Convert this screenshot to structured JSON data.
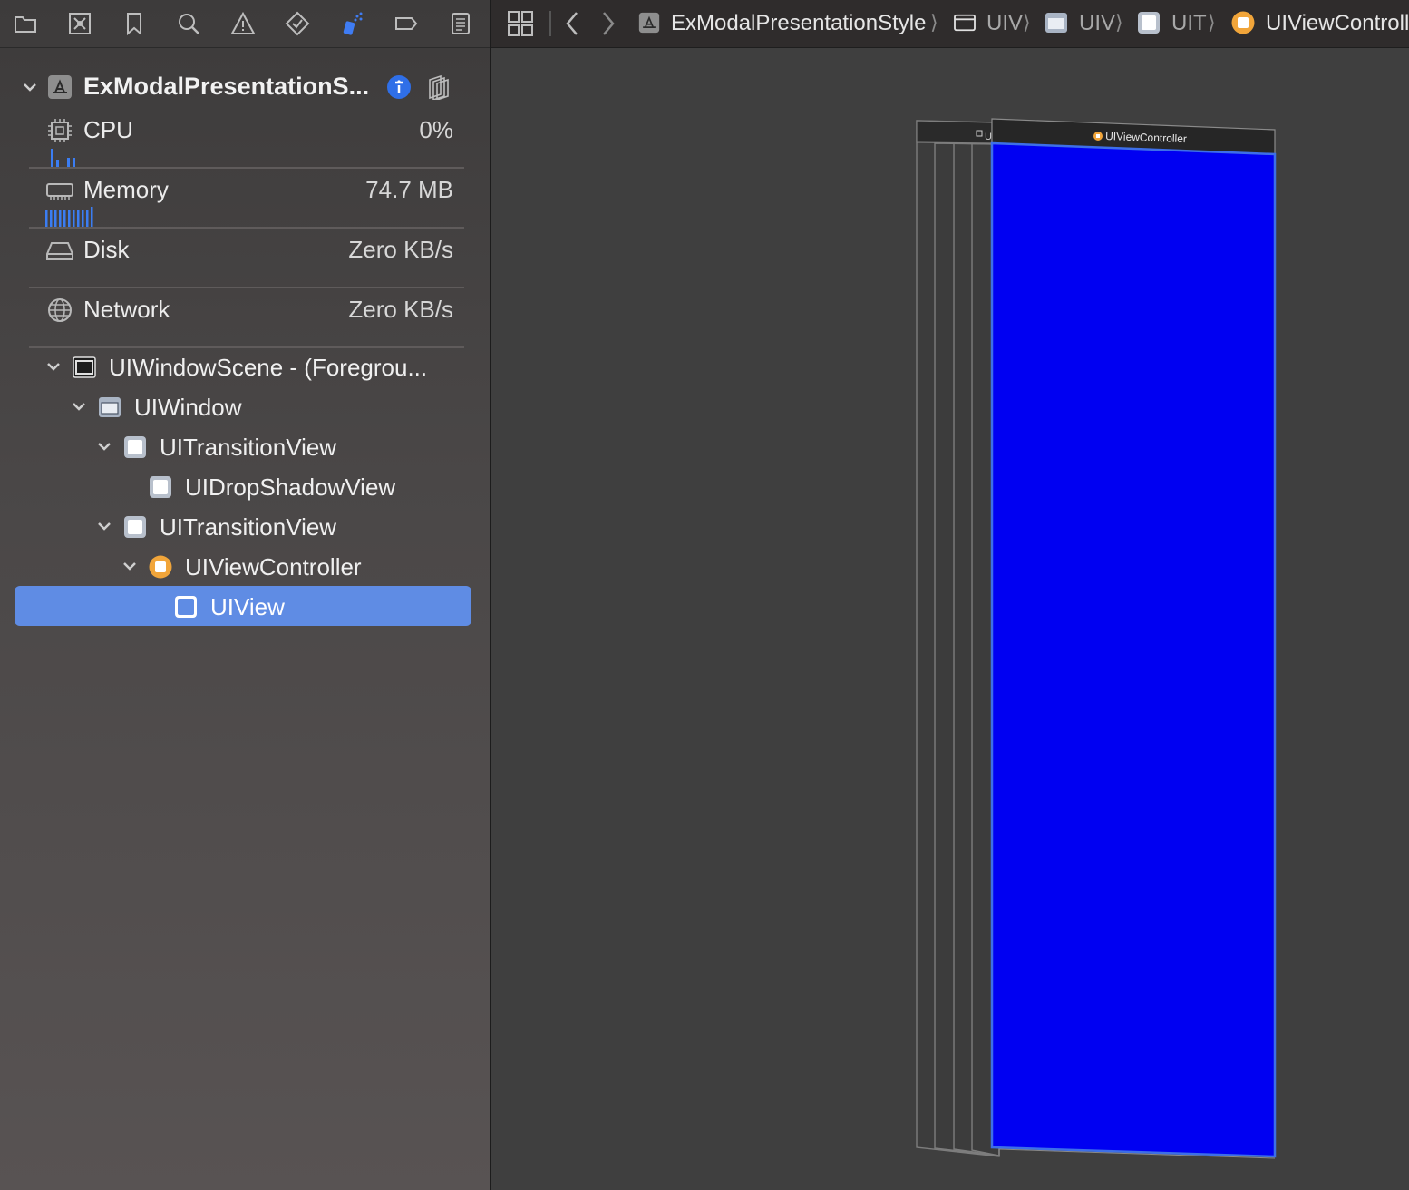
{
  "navigator": {
    "toolbar": [
      {
        "name": "project-navigator-icon"
      },
      {
        "name": "source-control-navigator-icon"
      },
      {
        "name": "bookmark-navigator-icon"
      },
      {
        "name": "find-navigator-icon"
      },
      {
        "name": "issue-navigator-icon"
      },
      {
        "name": "test-navigator-icon"
      },
      {
        "name": "debug-navigator-icon"
      },
      {
        "name": "breakpoint-navigator-icon"
      },
      {
        "name": "report-navigator-icon"
      }
    ],
    "process": {
      "title": "ExModalPresentationS...",
      "info_icon": "info-icon",
      "view_hierarchy_icon": "view-hierarchy-icon"
    },
    "gauges": [
      {
        "key": "cpu",
        "label": "CPU",
        "value": "0%",
        "icon": "cpu-icon"
      },
      {
        "key": "memory",
        "label": "Memory",
        "value": "74.7 MB",
        "icon": "memory-icon"
      },
      {
        "key": "disk",
        "label": "Disk",
        "value": "Zero KB/s",
        "icon": "disk-icon"
      },
      {
        "key": "network",
        "label": "Network",
        "value": "Zero KB/s",
        "icon": "network-icon"
      }
    ],
    "tree": [
      {
        "label": "UIWindowScene - (Foregrou...",
        "expanded": true
      },
      {
        "label": "UIWindow",
        "expanded": true
      },
      {
        "label": "UITransitionView",
        "expanded": true
      },
      {
        "label": "UIDropShadowView",
        "expanded": false
      },
      {
        "label": "UITransitionView",
        "expanded": true
      },
      {
        "label": "UIViewController",
        "expanded": true
      },
      {
        "label": "UIView",
        "selected": true
      }
    ]
  },
  "jumpbar": {
    "project": "ExModalPresentationStyle",
    "crumbs": [
      "UIV",
      "UIV",
      "UIT"
    ],
    "last": "UIViewControll"
  },
  "canvas": {
    "view_header_label": "UIViewController",
    "back_header_label": "U",
    "colors": {
      "selected_view": "#0000f2",
      "selection": "#5f8ce4",
      "accent_orange": "#f1a53a"
    }
  }
}
